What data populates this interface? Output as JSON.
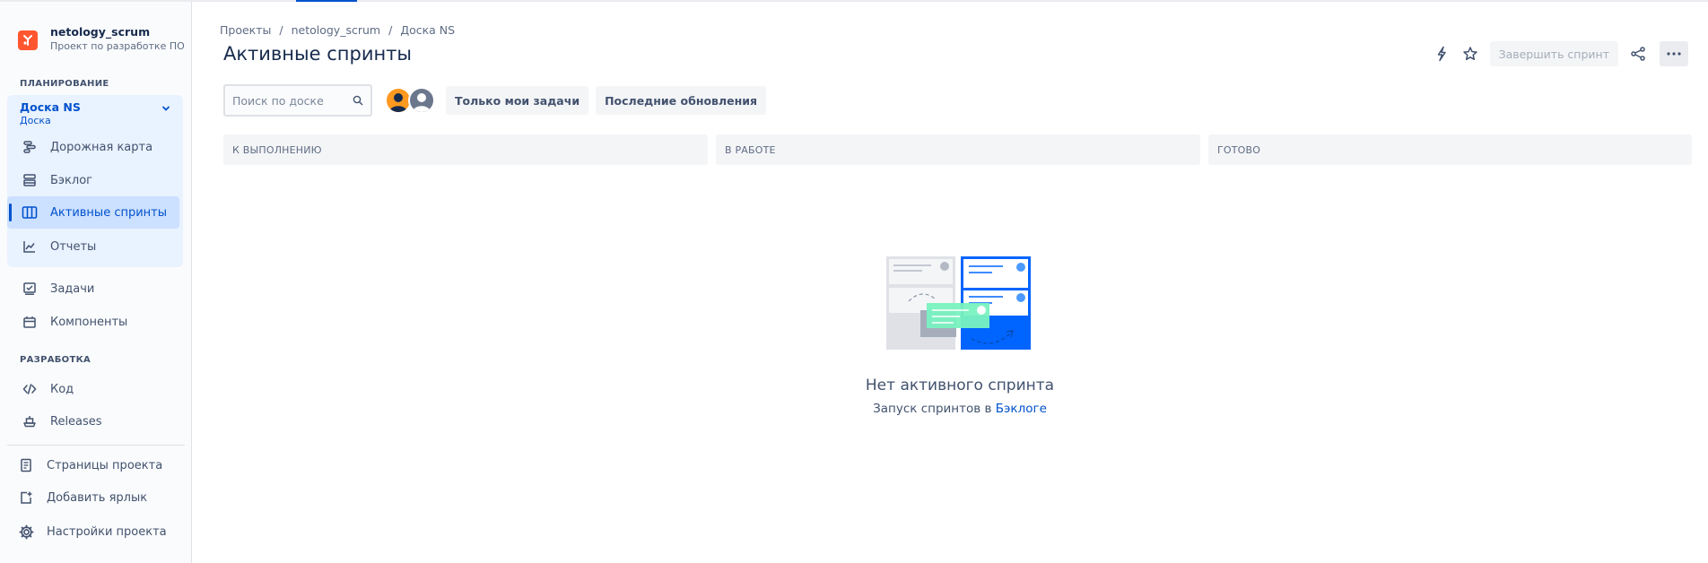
{
  "project": {
    "name": "netology_scrum",
    "type": "Проект по разработке ПО"
  },
  "sidebar": {
    "planning_title": "ПЛАНИРОВАНИЕ",
    "board": {
      "name": "Доска NS",
      "type": "Доска"
    },
    "board_items": [
      {
        "label": "Дорожная карта",
        "icon": "roadmap-icon"
      },
      {
        "label": "Бэклог",
        "icon": "backlog-icon"
      },
      {
        "label": "Активные спринты",
        "icon": "board-columns-icon"
      },
      {
        "label": "Отчеты",
        "icon": "reports-chart-icon"
      }
    ],
    "items": [
      {
        "label": "Задачи",
        "icon": "issues-icon"
      },
      {
        "label": "Компоненты",
        "icon": "components-icon"
      }
    ],
    "dev_title": "РАЗРАБОТКА",
    "dev_items": [
      {
        "label": "Код",
        "icon": "code-icon"
      },
      {
        "label": "Releases",
        "icon": "releases-ship-icon"
      }
    ],
    "footer_items": [
      {
        "label": "Страницы проекта",
        "icon": "pages-icon"
      },
      {
        "label": "Добавить ярлык",
        "icon": "add-shortcut-icon"
      },
      {
        "label": "Настройки проекта",
        "icon": "settings-gear-icon"
      }
    ]
  },
  "breadcrumb": [
    "Проекты",
    "netology_scrum",
    "Доска NS"
  ],
  "page_title": "Активные спринты",
  "actions": {
    "complete_sprint": "Завершить спринт"
  },
  "toolbar": {
    "search_placeholder": "Поиск по доске",
    "filter_mine": "Только мои задачи",
    "filter_recent": "Последние обновления"
  },
  "columns": [
    "К ВЫПОЛНЕНИЮ",
    "В РАБОТЕ",
    "ГОТОВО"
  ],
  "empty_state": {
    "title": "Нет активного спринта",
    "subtitle_prefix": "Запуск спринтов в",
    "subtitle_link": "Бэклоге"
  },
  "colors": {
    "accent": "#0052cc",
    "project_logo": "#ff5630",
    "selected_bg": "#cce0ff",
    "group_bg": "#e9f2ff"
  }
}
